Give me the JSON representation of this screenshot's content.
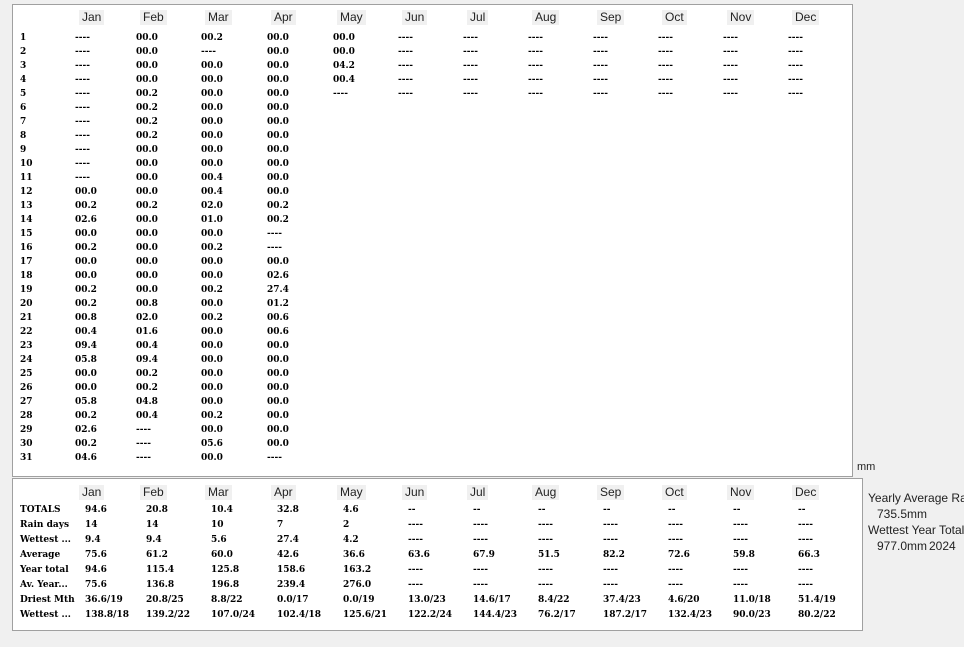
{
  "months": [
    "Jan",
    "Feb",
    "Mar",
    "Apr",
    "May",
    "Jun",
    "Jul",
    "Aug",
    "Sep",
    "Oct",
    "Nov",
    "Dec"
  ],
  "days": [
    "1",
    "2",
    "3",
    "4",
    "5",
    "6",
    "7",
    "8",
    "9",
    "10",
    "11",
    "12",
    "13",
    "14",
    "15",
    "16",
    "17",
    "18",
    "19",
    "20",
    "21",
    "22",
    "23",
    "24",
    "25",
    "26",
    "27",
    "28",
    "29",
    "30",
    "31"
  ],
  "daily": [
    [
      "----",
      "----",
      "----",
      "----",
      "----",
      "----",
      "----",
      "----",
      "----",
      "----",
      "----",
      "00.0",
      "00.2",
      "02.6",
      "00.0",
      "00.2",
      "00.0",
      "00.0",
      "00.2",
      "00.2",
      "00.8",
      "00.4",
      "09.4",
      "05.8",
      "00.0",
      "00.0",
      "05.8",
      "00.2",
      "02.6",
      "00.2",
      "04.6"
    ],
    [
      "00.0",
      "00.0",
      "00.0",
      "00.0",
      "00.2",
      "00.2",
      "00.2",
      "00.2",
      "00.0",
      "00.0",
      "00.0",
      "00.0",
      "00.2",
      "00.0",
      "00.0",
      "00.0",
      "00.0",
      "00.0",
      "00.0",
      "00.8",
      "02.0",
      "01.6",
      "00.4",
      "09.4",
      "00.2",
      "00.2",
      "04.8",
      "00.4",
      "----",
      "----",
      "----"
    ],
    [
      "00.2",
      "----",
      "00.0",
      "00.0",
      "00.0",
      "00.0",
      "00.0",
      "00.0",
      "00.0",
      "00.0",
      "00.4",
      "00.4",
      "02.0",
      "01.0",
      "00.0",
      "00.2",
      "00.0",
      "00.0",
      "00.2",
      "00.0",
      "00.2",
      "00.0",
      "00.0",
      "00.0",
      "00.0",
      "00.0",
      "00.0",
      "00.2",
      "00.0",
      "05.6",
      "00.0"
    ],
    [
      "00.0",
      "00.0",
      "00.0",
      "00.0",
      "00.0",
      "00.0",
      "00.0",
      "00.0",
      "00.0",
      "00.0",
      "00.0",
      "00.0",
      "00.2",
      "00.2",
      "----",
      "----",
      "00.0",
      "02.6",
      "27.4",
      "01.2",
      "00.6",
      "00.6",
      "00.0",
      "00.0",
      "00.0",
      "00.0",
      "00.0",
      "00.0",
      "00.0",
      "00.0",
      "----"
    ],
    [
      "00.0",
      "00.0",
      "04.2",
      "00.4",
      "----"
    ],
    [
      "----",
      "----",
      "----",
      "----",
      "----"
    ],
    [
      "----",
      "----",
      "----",
      "----",
      "----"
    ],
    [
      "----",
      "----",
      "----",
      "----",
      "----"
    ],
    [
      "----",
      "----",
      "----",
      "----",
      "----"
    ],
    [
      "----",
      "----",
      "----",
      "----",
      "----"
    ],
    [
      "----",
      "----",
      "----",
      "----",
      "----"
    ],
    [
      "----",
      "----",
      "----",
      "----",
      "----"
    ]
  ],
  "summary": {
    "rows": [
      {
        "label": "TOTALS",
        "values": [
          "94.6",
          "20.8",
          "10.4",
          "32.8",
          "4.6",
          "--",
          "--",
          "--",
          "--",
          "--",
          "--",
          "--"
        ]
      },
      {
        "label": "Rain days",
        "values": [
          "14",
          "14",
          "10",
          "7",
          "2",
          "----",
          "----",
          "----",
          "----",
          "----",
          "----",
          "----"
        ]
      },
      {
        "label": "Wettest ...",
        "values": [
          "9.4",
          "9.4",
          "5.6",
          "27.4",
          "4.2",
          "----",
          "----",
          "----",
          "----",
          "----",
          "----",
          "----"
        ]
      },
      {
        "label": "Average",
        "values": [
          "75.6",
          "61.2",
          "60.0",
          "42.6",
          "36.6",
          "63.6",
          "67.9",
          "51.5",
          "82.2",
          "72.6",
          "59.8",
          "66.3"
        ]
      },
      {
        "label": "Year total",
        "values": [
          "94.6",
          "115.4",
          "125.8",
          "158.6",
          "163.2",
          "----",
          "----",
          "----",
          "----",
          "----",
          "----",
          "----"
        ]
      },
      {
        "label": "Av. Year...",
        "values": [
          "75.6",
          "136.8",
          "196.8",
          "239.4",
          "276.0",
          "----",
          "----",
          "----",
          "----",
          "----",
          "----",
          "----"
        ]
      },
      {
        "label": "Driest Mth",
        "values": [
          "36.6/19",
          "20.8/25",
          "8.8/22",
          "0.0/17",
          "0.0/19",
          "13.0/23",
          "14.6/17",
          "8.4/22",
          "37.4/23",
          "4.6/20",
          "11.0/18",
          "51.4/19"
        ]
      },
      {
        "label": "Wettest ...",
        "values": [
          "138.8/18",
          "139.2/22",
          "107.0/24",
          "102.4/18",
          "125.6/21",
          "122.2/24",
          "144.4/23",
          "76.2/17",
          "187.2/17",
          "132.4/23",
          "90.0/23",
          "80.2/22"
        ]
      }
    ]
  },
  "unit_label": "mm",
  "sidebar": {
    "yearly_avg_label": "Yearly Average Rain",
    "yearly_avg_value": "735.5mm",
    "wettest_year_label": "Wettest Year Total",
    "wettest_year_value": "977.0mm",
    "wettest_year": "2024"
  }
}
